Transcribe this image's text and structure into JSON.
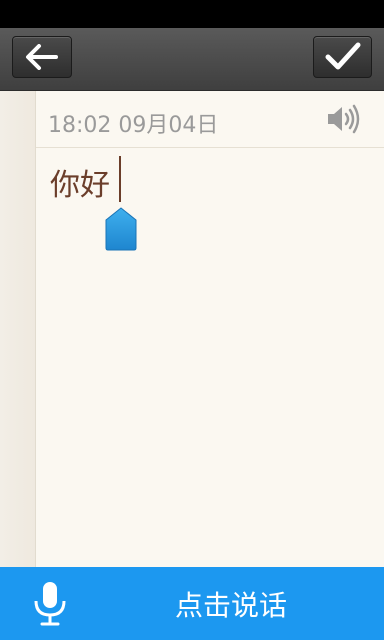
{
  "toolbar": {
    "back_icon": "back-arrow-icon",
    "confirm_icon": "checkmark-icon"
  },
  "note": {
    "timestamp": "18:02 09月04日",
    "speaker_icon": "speaker-icon",
    "text": "你好"
  },
  "voice_input": {
    "mic_icon": "microphone-icon",
    "label": "点击说话"
  },
  "colors": {
    "toolbar": "#4a4a4a",
    "paper": "#fbf8f1",
    "voice_bar": "#1c98f0",
    "text": "#6b3e2a",
    "handle": "#2a9be3"
  }
}
